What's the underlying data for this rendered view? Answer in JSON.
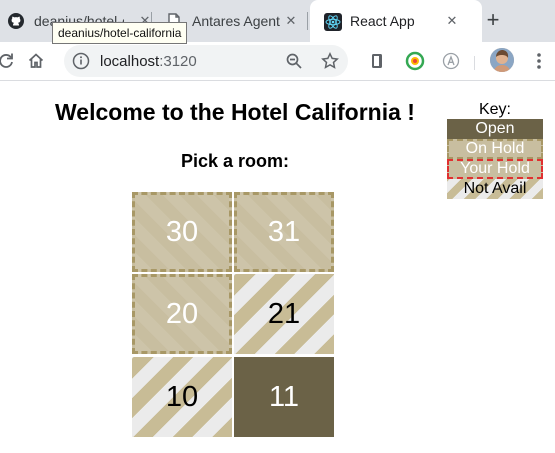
{
  "browser": {
    "tabs": [
      {
        "title": "deanius/hotel-california",
        "favicon": "github-icon"
      },
      {
        "title": "Antares Agent",
        "favicon": "document-icon"
      },
      {
        "title": "React App",
        "favicon": "react-icon"
      }
    ],
    "tooltip": "deanius/hotel-california",
    "url_host": "localhost",
    "url_port": ":3120"
  },
  "page": {
    "heading": "Welcome to the Hotel California !",
    "subheading": "Pick a room:",
    "rooms": [
      {
        "number": "30",
        "status": "on-hold"
      },
      {
        "number": "31",
        "status": "on-hold"
      },
      {
        "number": "20",
        "status": "on-hold"
      },
      {
        "number": "21",
        "status": "not-available"
      },
      {
        "number": "10",
        "status": "not-available"
      },
      {
        "number": "11",
        "status": "open"
      }
    ],
    "key": {
      "title": "Key:",
      "open": "Open",
      "on_hold": "On Hold",
      "your_hold": "Your Hold",
      "not_avail": "Not Avail"
    }
  },
  "colors": {
    "open": "#6b6247",
    "on_hold": "#c8bea0",
    "hold_border": "#a89866",
    "your_hold_border": "#e03030",
    "not_avail_stripe": "#c8bc96"
  }
}
